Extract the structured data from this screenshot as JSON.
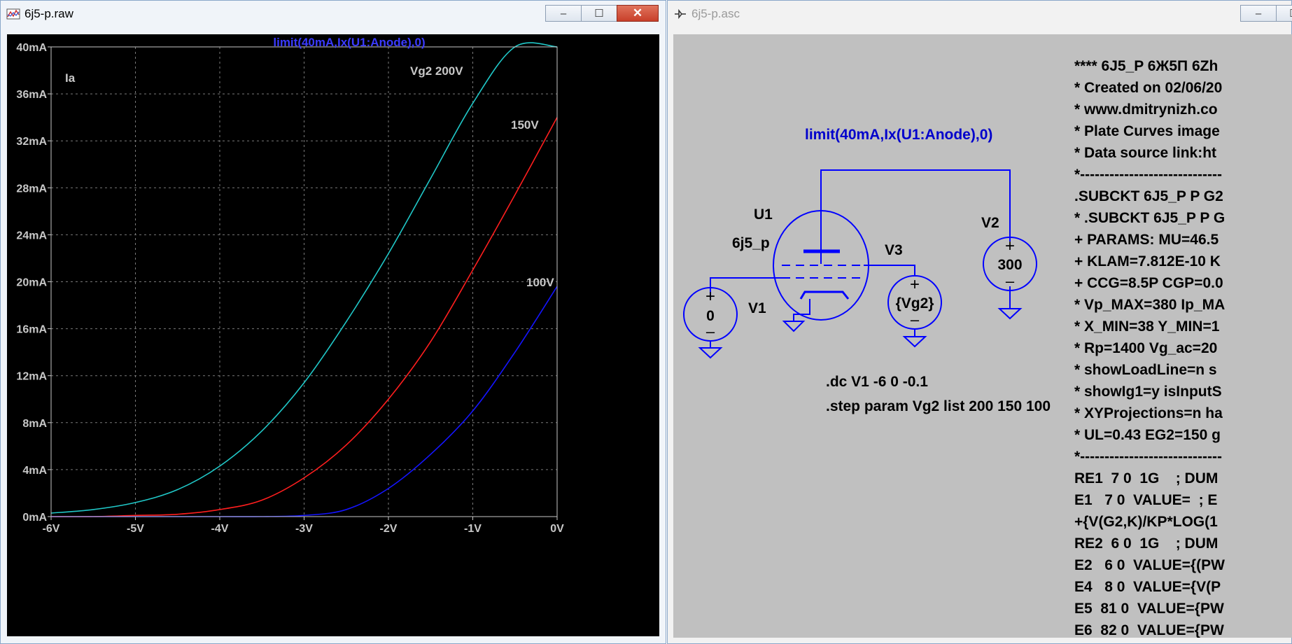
{
  "plot_window": {
    "title": "6j5-p.raw",
    "trace_label": "limit(40mA,Ix(U1:Anode),0)",
    "y_axis_label": "Ia",
    "colors": {
      "background": "#000000",
      "grid": "#7a7a7a",
      "axis_text": "#c8c8c8",
      "trace_label": "#3a3aff"
    }
  },
  "chart_data": {
    "type": "line",
    "title": "limit(40mA,Ix(U1:Anode),0)",
    "ylabel": "Ia",
    "xlabel": "",
    "x_tick_labels": [
      "-6V",
      "-5V",
      "-4V",
      "-3V",
      "-2V",
      "-1V",
      "0V"
    ],
    "y_tick_labels": [
      "0mA",
      "4mA",
      "8mA",
      "12mA",
      "16mA",
      "20mA",
      "24mA",
      "28mA",
      "32mA",
      "36mA",
      "40mA"
    ],
    "xlim": [
      -6,
      0
    ],
    "ylim": [
      0,
      40
    ],
    "grid": true,
    "x": [
      -6.0,
      -5.5,
      -5.0,
      -4.5,
      -4.0,
      -3.5,
      -3.0,
      -2.5,
      -2.0,
      -1.5,
      -1.0,
      -0.5,
      0.0
    ],
    "series": [
      {
        "name": "Vg2 200V",
        "color": "#20c8c8",
        "values": [
          0.3,
          0.6,
          1.2,
          2.3,
          4.3,
          7.3,
          11.4,
          16.6,
          22.4,
          28.8,
          35.2,
          40.0,
          40.0
        ]
      },
      {
        "name": "150V",
        "color": "#ff1e1e",
        "values": [
          0.0,
          0.0,
          0.1,
          0.2,
          0.6,
          1.4,
          3.3,
          6.1,
          10.0,
          14.9,
          21.0,
          27.4,
          34.0
        ]
      },
      {
        "name": "100V",
        "color": "#1414ff",
        "values": [
          0.0,
          0.0,
          0.0,
          0.0,
          0.0,
          0.0,
          0.1,
          0.6,
          2.4,
          5.3,
          9.0,
          14.0,
          19.6
        ]
      }
    ]
  },
  "schematic_window": {
    "title": "6j5-p.asc",
    "probe_label": "limit(40mA,Ix(U1:Anode),0)",
    "tube_ref": "U1",
    "tube_model": "6j5_p",
    "v1_name": "V1",
    "v1_value": "0",
    "v2_name": "V2",
    "v2_value": "300",
    "v3_name": "V3",
    "v3_value": "{Vg2}",
    "directive_dc": ".dc V1 -6 0 -0.1",
    "directive_step": ".step param Vg2 list 200 150 100",
    "netlist_lines": [
      "**** 6J5_P 6Ж5П 6Zh",
      "* Created on 02/06/20",
      "* www.dmitrynizh.co",
      "* Plate Curves image",
      "* Data source link:ht",
      "*-----------------------------",
      ".SUBCKT 6J5_P P G2",
      "* .SUBCKT 6J5_P P G",
      "+ PARAMS: MU=46.5",
      "+ KLAM=7.812E-10 K",
      "+ CCG=8.5P CGP=0.0",
      "* Vp_MAX=380 Ip_MA",
      "* X_MIN=38 Y_MIN=1",
      "* Rp=1400 Vg_ac=20",
      "* showLoadLine=n s",
      "* showIg1=y isInputS",
      "* XYProjections=n ha",
      "* UL=0.43 EG2=150 g",
      "*-----------------------------",
      "RE1  7 0  1G    ; DUM",
      "E1   7 0  VALUE=  ; E",
      "+{V(G2,K)/KP*LOG(1",
      "RE2  6 0  1G    ; DUM",
      "E2   6 0  VALUE={(PW",
      "E4   8 0  VALUE={V(P",
      "E5  81 0  VALUE={PW",
      "E6  82 0  VALUE={PW"
    ],
    "colors": {
      "wire": "#0000ff",
      "canvas": "#c0c0c0",
      "text": "#000000",
      "probe": "#0000cc"
    }
  },
  "window_controls": {
    "minimize": "–",
    "maximize": "☐",
    "close": "✕"
  }
}
